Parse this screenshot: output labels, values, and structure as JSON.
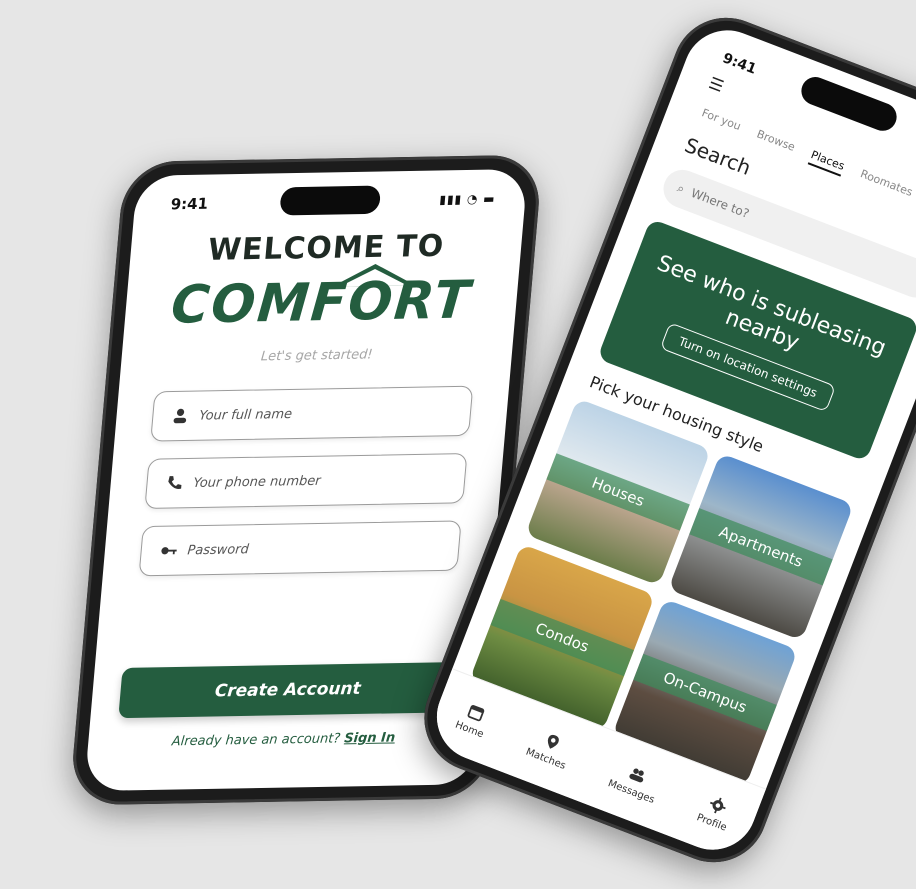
{
  "signup": {
    "status_time": "9:41",
    "welcome": "WELCOME TO",
    "logo": "COMFORT",
    "tagline": "Let's get started!",
    "name_placeholder": "Your full name",
    "phone_placeholder": "Your phone number",
    "password_placeholder": "Password",
    "create_button": "Create Account",
    "signin_prompt": "Already have an account?",
    "signin_link": "Sign In"
  },
  "home": {
    "status_time": "9:41",
    "tabs": [
      "For you",
      "Browse",
      "Places",
      "Roomates"
    ],
    "active_tab": "Places",
    "search_title": "Search",
    "search_placeholder": "Where to?",
    "banner_title": "See who is subleasing nearby",
    "banner_button": "Turn on location settings",
    "section_title": "Pick your housing style",
    "tiles": [
      "Houses",
      "Apartments",
      "Condos",
      "On-Campus"
    ],
    "nav": [
      "Home",
      "Matches",
      "Messages",
      "Profile"
    ]
  },
  "colors": {
    "accent": "#245d3f",
    "background": "#e6e6e6"
  }
}
